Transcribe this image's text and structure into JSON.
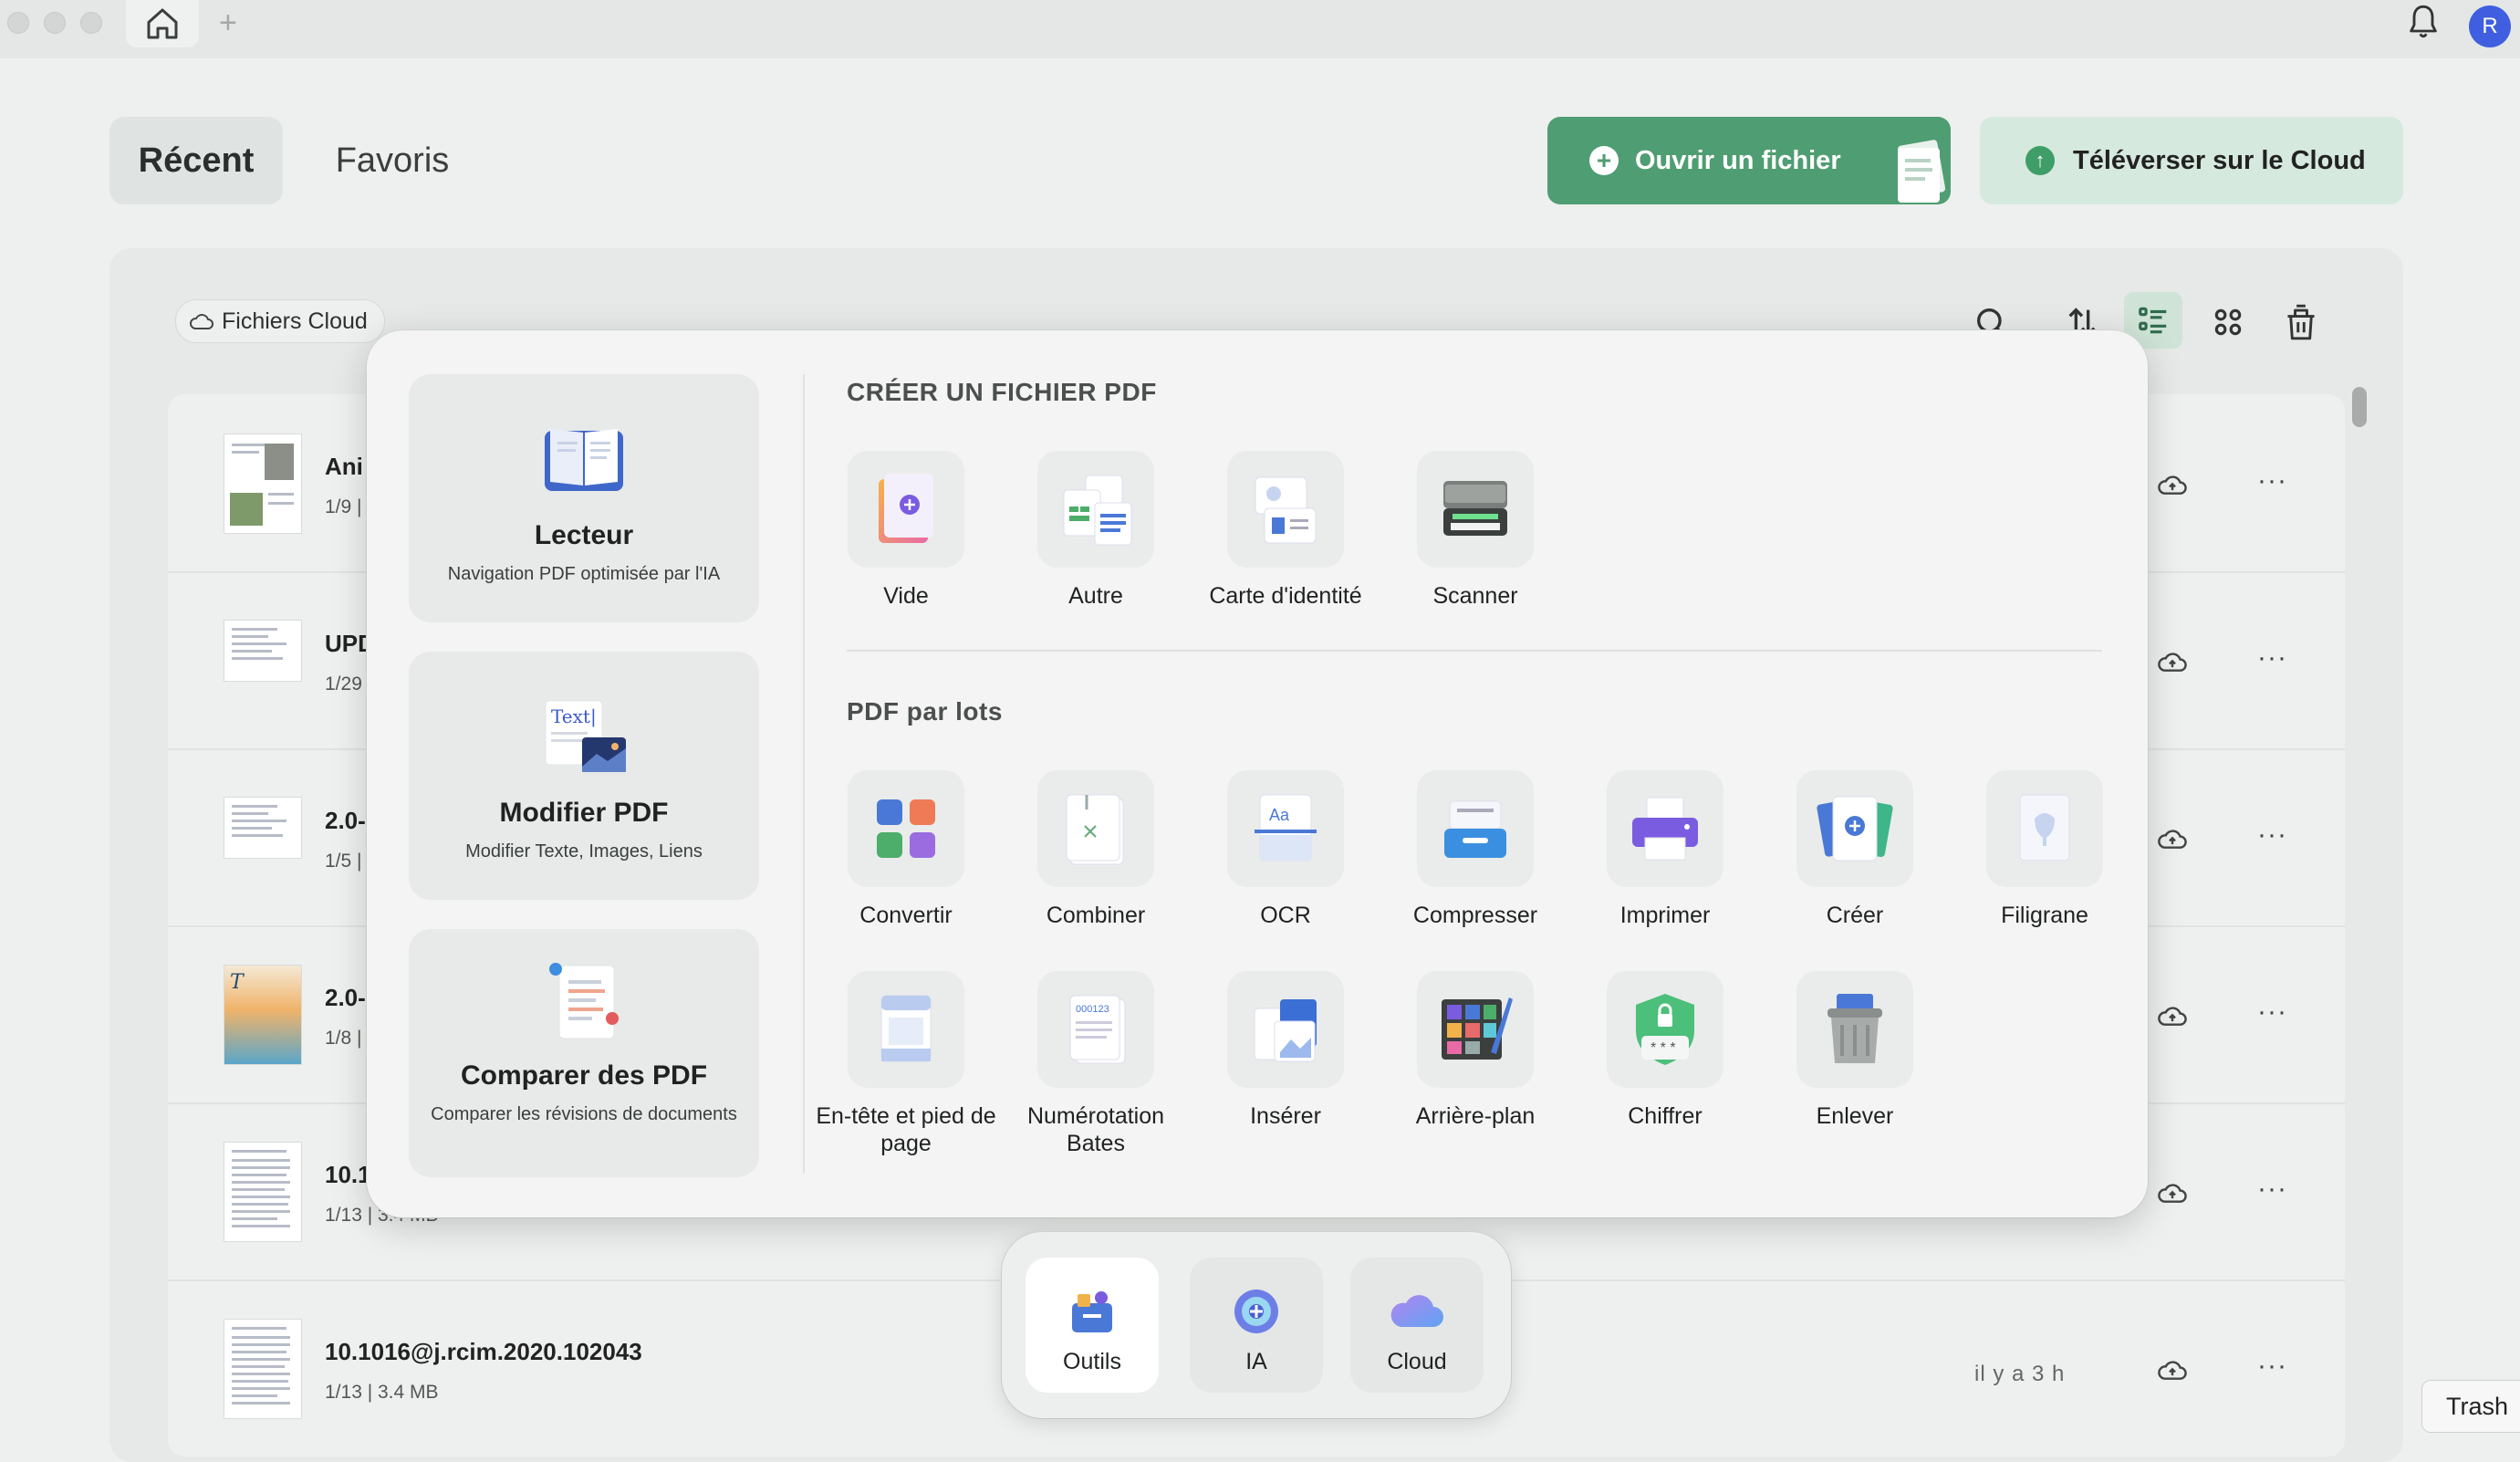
{
  "titlebar": {
    "avatar_initial": "R",
    "new_tab": "+"
  },
  "nav": {
    "tab_recent": "Récent",
    "tab_favorites": "Favoris",
    "open_file": "Ouvrir un fichier",
    "upload_cloud": "Téléverser sur le Cloud"
  },
  "list": {
    "cloud_files_chip": "Fichiers Cloud",
    "rows": [
      {
        "name": "Ani",
        "meta": "1/9 |",
        "time": ""
      },
      {
        "name": "UPD",
        "meta": "1/29",
        "time": ""
      },
      {
        "name": "2.0-",
        "meta": "1/5 |",
        "time": ""
      },
      {
        "name": "2.0-",
        "meta": "1/8 |",
        "time": ""
      },
      {
        "name": "10.1",
        "meta": "1/13 | 3.4 MB",
        "time": ""
      },
      {
        "name": "10.1016@j.rcim.2020.102043",
        "meta": "1/13 | 3.4 MB",
        "time": "il y a 3 h"
      }
    ]
  },
  "popup": {
    "features": [
      {
        "title": "Lecteur",
        "desc": "Navigation PDF optimisée par l'IA"
      },
      {
        "title": "Modifier PDF",
        "desc": "Modifier Texte, Images, Liens",
        "icon_text": "Text|"
      },
      {
        "title": "Comparer des PDF",
        "desc": "Comparer les révisions de documents"
      }
    ],
    "create_title": "CRÉER UN FICHIER PDF",
    "create_tools": [
      "Vide",
      "Autre",
      "Carte d'identité",
      "Scanner"
    ],
    "batch_title": "PDF par lots",
    "batch_tools": [
      "Convertir",
      "Combiner",
      "OCR",
      "Compresser",
      "Imprimer",
      "Créer",
      "Filigrane",
      "En-tête et pied de page",
      "Numérotation Bates",
      "Insérer",
      "Arrière-plan",
      "Chiffrer",
      "Enlever"
    ],
    "ocr_icon_text": "Aa",
    "bates_icon_text": "000123"
  },
  "dock": {
    "tools": "Outils",
    "ai": "IA",
    "cloud": "Cloud"
  },
  "tooltip": {
    "trash": "Trash"
  },
  "colors": {
    "accent_green": "#4f9d72",
    "light_green": "#d6e9de",
    "avatar_blue": "#3f5fe0"
  }
}
